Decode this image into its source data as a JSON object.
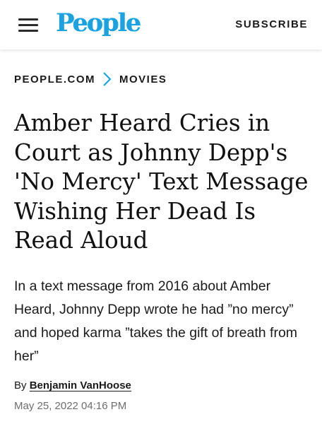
{
  "header": {
    "menu_icon": "hamburger-menu-icon",
    "logo_text": "People",
    "subscribe_label": "SUBSCRIBE",
    "logo_color": "#1aa3e0"
  },
  "breadcrumb": {
    "items": [
      "PEOPLE.COM",
      "MOVIES"
    ],
    "separator_icon": "chevron-right-icon",
    "separator_color": "#1aa3e0"
  },
  "article": {
    "headline": "Amber Heard Cries in Court as Johnny Depp's 'No Mercy' Text Message Wishing Her Dead Is Read Aloud",
    "dek": "In a text message from 2016 about Amber Heard, Johnny Depp wrote he had ”no mercy” and hoped karma ”takes the gift of breath from her”",
    "byline_prefix": "By",
    "author": "Benjamin VanHoose",
    "date": "May 25, 2022 04:16 PM"
  }
}
